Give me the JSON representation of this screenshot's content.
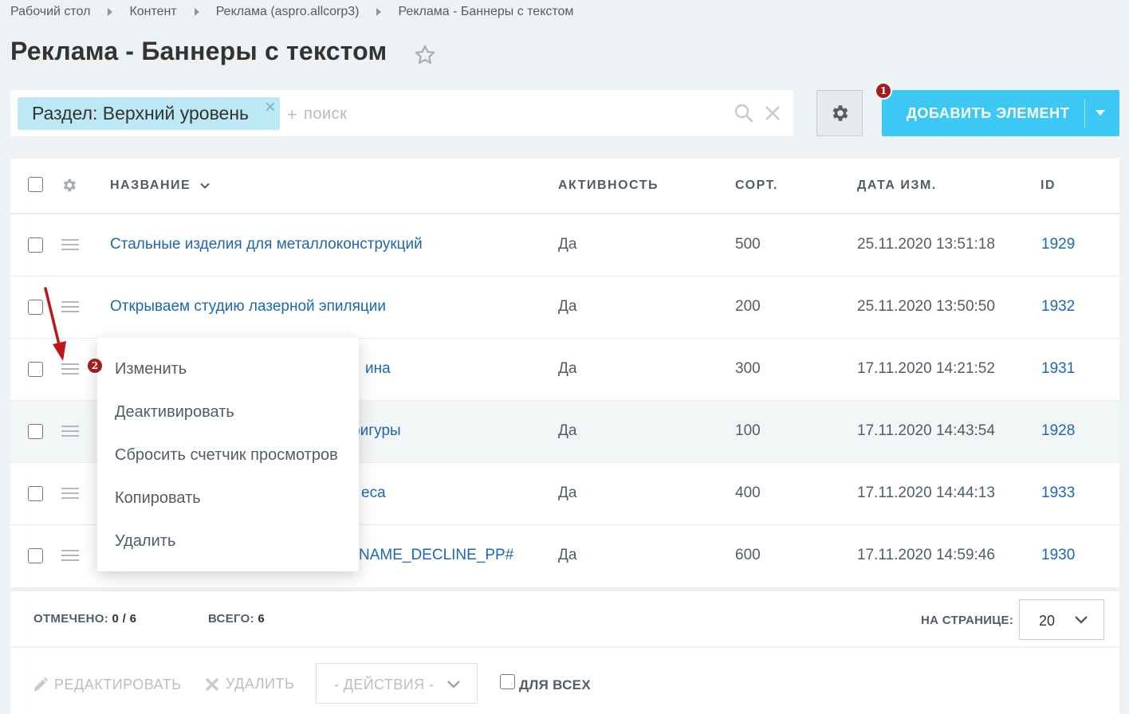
{
  "breadcrumb": [
    "Рабочий стол",
    "Контент",
    "Реклама (aspro.allcorp3)",
    "Реклама - Баннеры с текстом"
  ],
  "page_title": "Реклама - Баннеры с текстом",
  "filter": {
    "tag": "Раздел: Верхний уровень",
    "plus": "+",
    "search_placeholder": "поиск"
  },
  "add_button": {
    "label": "ДОБАВИТЬ ЭЛЕМЕНТ",
    "badge": "1"
  },
  "columns": {
    "name": "НАЗВАНИЕ",
    "active": "АКТИВНОСТЬ",
    "sort": "СОРТ.",
    "date": "ДАТА ИЗМ.",
    "id": "ID"
  },
  "rows": [
    {
      "name": "Стальные изделия для металлоконструкций",
      "active": "Да",
      "sort": "500",
      "date": "25.11.2020 13:51:18",
      "id": "1929"
    },
    {
      "name": "Открываем студию лазерной эпиляции",
      "active": "Да",
      "sort": "200",
      "date": "25.11.2020 13:50:50",
      "id": "1932"
    },
    {
      "name": "ина",
      "active": "Да",
      "sort": "300",
      "date": "17.11.2020 14:21:52",
      "id": "1931"
    },
    {
      "name": "фигуры",
      "active": "Да",
      "sort": "100",
      "date": "17.11.2020 14:43:54",
      "id": "1928"
    },
    {
      "name": "еса",
      "active": "Да",
      "sort": "400",
      "date": "17.11.2020 14:44:13",
      "id": "1933"
    },
    {
      "name": "NAME_DECLINE_PP#",
      "active": "Да",
      "sort": "600",
      "date": "17.11.2020 14:59:46",
      "id": "1930"
    }
  ],
  "context_menu": {
    "badge": "2",
    "items": [
      "Изменить",
      "Деактивировать",
      "Сбросить счетчик просмотров",
      "Копировать",
      "Удалить"
    ]
  },
  "footer": {
    "selected_label": "ОТМЕЧЕНО:",
    "selected_value": "0 / 6",
    "total_label": "ВСЕГО:",
    "total_value": "6",
    "per_page_label": "НА СТРАНИЦЕ:",
    "per_page_value": "20"
  },
  "action_bar": {
    "edit": "РЕДАКТИРОВАТЬ",
    "delete": "УДАЛИТЬ",
    "actions": "- ДЕЙСТВИЯ -",
    "for_all": "ДЛЯ ВСЕХ"
  },
  "colors": {
    "accent": "#3bc8f5",
    "link": "#2067b0",
    "badge": "#a61b1b",
    "arrow": "#c0161c"
  }
}
